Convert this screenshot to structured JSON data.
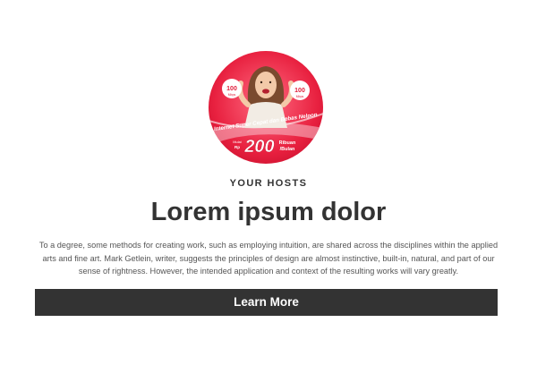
{
  "hosts": {
    "image": {
      "headline": "Internet Super Cepat dan Bebas Nelpon",
      "price_prefix": "Rp",
      "price": "200",
      "price_suffix_1": "Ribuan",
      "price_suffix_2": "/Bulan",
      "badge_value": "100",
      "badge_unit": "Mbps",
      "start_label": "Mulai",
      "brand_colors": {
        "primary": "#e11d3a",
        "light": "#f7c1cc",
        "white": "#ffffff"
      }
    },
    "eyebrow": "YOUR HOSTS",
    "heading": "Lorem ipsum dolor",
    "body": "To a degree, some methods for creating work, such as employing intuition, are shared across the disciplines within the applied arts and fine art. Mark Getlein, writer, suggests the principles of design are almost instinctive, built-in, natural, and part of our sense of rightness. However, the intended application and context of the resulting works will vary greatly.",
    "cta_label": "Learn More",
    "colors": {
      "cta_background": "#333333",
      "cta_text": "#ffffff",
      "text": "#333333"
    }
  }
}
